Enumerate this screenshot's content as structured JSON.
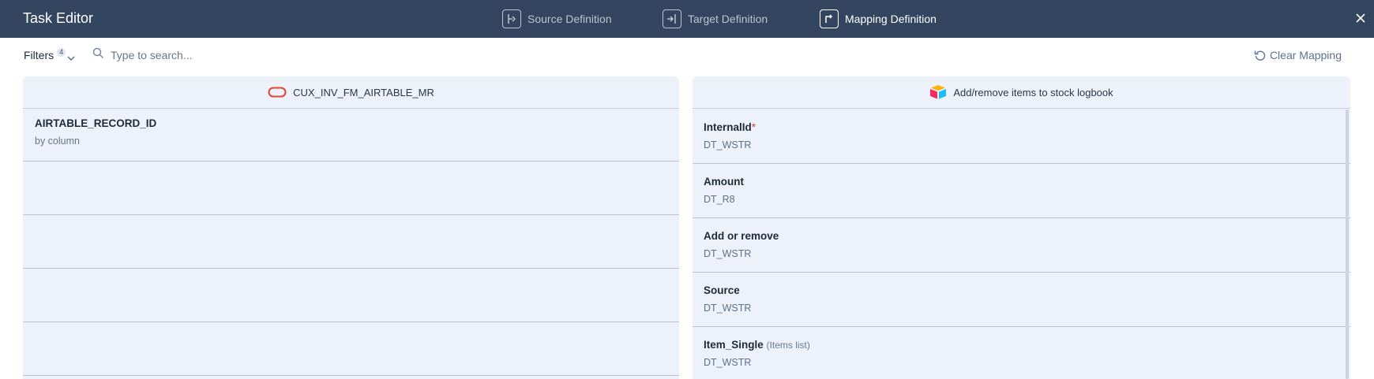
{
  "header": {
    "title": "Task Editor",
    "tabs": [
      {
        "label": "Source Definition",
        "icon": "source-definition-icon",
        "active": false
      },
      {
        "label": "Target Definition",
        "icon": "target-definition-icon",
        "active": false
      },
      {
        "label": "Mapping Definition",
        "icon": "mapping-definition-icon",
        "active": true
      }
    ],
    "close_icon": "close-icon",
    "background": "#34465f"
  },
  "toolbar": {
    "filters_label": "Filters",
    "filters_count": "4",
    "search_placeholder": "Type to search...",
    "search_value": "",
    "clear_label": "Clear Mapping"
  },
  "source": {
    "title": "CUX_INV_FM_AIRTABLE_MR",
    "icon": "oracle-icon",
    "icon_color": "#e0452f",
    "rows": [
      {
        "name": "AIRTABLE_RECORD_ID",
        "sub": "by column"
      }
    ]
  },
  "target": {
    "title": "Add/remove items to stock logbook",
    "icon": "airtable-icon",
    "fields": [
      {
        "name": "InternalId",
        "required": "*",
        "hint": "",
        "type": "DT_WSTR"
      },
      {
        "name": "Amount",
        "required": "",
        "hint": "",
        "type": "DT_R8"
      },
      {
        "name": "Add or remove",
        "required": "",
        "hint": "",
        "type": "DT_WSTR"
      },
      {
        "name": "Source",
        "required": "",
        "hint": "",
        "type": "DT_WSTR"
      },
      {
        "name": "Item_Single",
        "required": "",
        "hint": "(Items list)",
        "type": "DT_WSTR"
      }
    ]
  }
}
